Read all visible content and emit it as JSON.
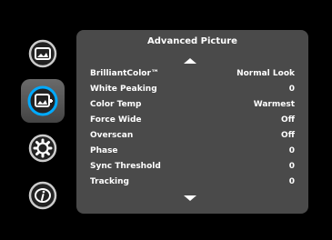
{
  "sidebar": {
    "items": [
      {
        "icon": "picture-icon",
        "active": false
      },
      {
        "icon": "advanced-picture-icon",
        "active": true
      },
      {
        "icon": "gear-icon",
        "active": false
      },
      {
        "icon": "info-icon",
        "active": false
      }
    ]
  },
  "menu": {
    "title": "Advanced Picture",
    "rows": [
      {
        "label": "BrilliantColor™",
        "value": "Normal Look"
      },
      {
        "label": "White Peaking",
        "value": "0"
      },
      {
        "label": "Color Temp",
        "value": "Warmest"
      },
      {
        "label": "Force Wide",
        "value": "Off"
      },
      {
        "label": "Overscan",
        "value": "Off"
      },
      {
        "label": "Phase",
        "value": "0"
      },
      {
        "label": "Sync Threshold",
        "value": "0"
      },
      {
        "label": "Tracking",
        "value": "0"
      }
    ]
  },
  "colors": {
    "background": "#000000",
    "panel": "#4a4a4a",
    "icon_ring": "#cccccc",
    "icon_highlight": "#00aaff",
    "text": "#ffffff"
  }
}
